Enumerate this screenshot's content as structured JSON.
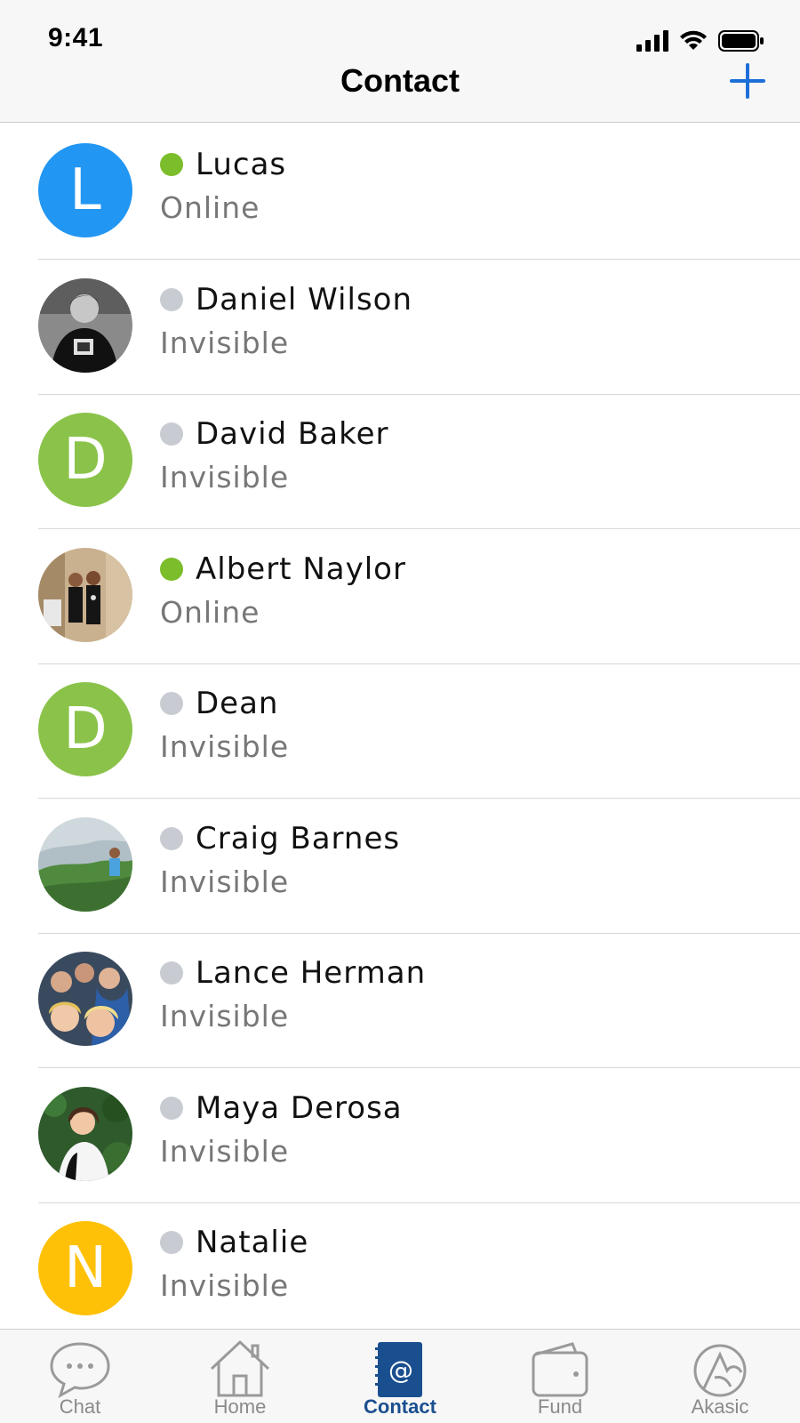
{
  "status_bar": {
    "time": "9:41"
  },
  "nav": {
    "title": "Contact",
    "add_icon": "plus-icon",
    "accent": "#1d6fd8"
  },
  "colors": {
    "online": "#7bbd2a",
    "invisible": "#c8ccd2"
  },
  "contacts": [
    {
      "name": "Lucas",
      "status": "Online",
      "presence": "online",
      "avatar_type": "letter",
      "initial": "L",
      "avatar_color": "#2196f3"
    },
    {
      "name": "Daniel Wilson",
      "status": "Invisible",
      "presence": "invisible",
      "avatar_type": "photo",
      "photo": "man-black-tshirt"
    },
    {
      "name": "David Baker",
      "status": "Invisible",
      "presence": "invisible",
      "avatar_type": "letter",
      "initial": "D",
      "avatar_color": "#8bc34a"
    },
    {
      "name": "Albert Naylor",
      "status": "Online",
      "presence": "online",
      "avatar_type": "photo",
      "photo": "two-people-shop"
    },
    {
      "name": "Dean",
      "status": "Invisible",
      "presence": "invisible",
      "avatar_type": "letter",
      "initial": "D",
      "avatar_color": "#8bc34a"
    },
    {
      "name": "Craig Barnes",
      "status": "Invisible",
      "presence": "invisible",
      "avatar_type": "photo",
      "photo": "hills-landscape"
    },
    {
      "name": "Lance Herman",
      "status": "Invisible",
      "presence": "invisible",
      "avatar_type": "photo",
      "photo": "group-selfie"
    },
    {
      "name": "Maya Derosa",
      "status": "Invisible",
      "presence": "invisible",
      "avatar_type": "photo",
      "photo": "woman-foliage"
    },
    {
      "name": "Natalie",
      "status": "Invisible",
      "presence": "invisible",
      "avatar_type": "letter",
      "initial": "N",
      "avatar_color": "#ffc107"
    }
  ],
  "tabbar": {
    "tabs": [
      {
        "label": "Chat",
        "icon": "chat-bubble-icon",
        "active": false
      },
      {
        "label": "Home",
        "icon": "house-icon",
        "active": false
      },
      {
        "label": "Contact",
        "icon": "contact-book-icon",
        "active": true
      },
      {
        "label": "Fund",
        "icon": "wallet-icon",
        "active": false
      },
      {
        "label": "Akasic",
        "icon": "akasic-logo-icon",
        "active": false
      }
    ]
  }
}
